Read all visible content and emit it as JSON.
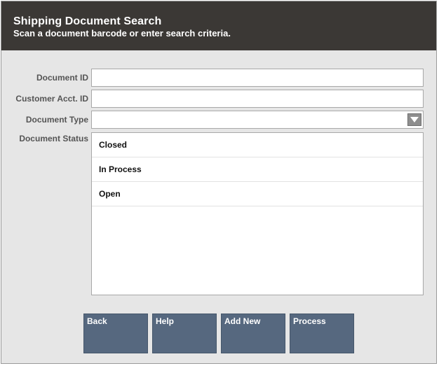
{
  "header": {
    "title": "Shipping Document Search",
    "subtitle": "Scan a document barcode or enter search criteria."
  },
  "form": {
    "document_id": {
      "label": "Document ID",
      "value": ""
    },
    "customer_acct_id": {
      "label": "Customer Acct. ID",
      "value": ""
    },
    "document_type": {
      "label": "Document Type",
      "value": ""
    },
    "document_status": {
      "label": "Document Status",
      "options": [
        "Closed",
        "In Process",
        "Open"
      ]
    }
  },
  "buttons": {
    "back": "Back",
    "help": "Help",
    "add_new": "Add New",
    "process": "Process"
  },
  "colors": {
    "header_bg": "#3b3835",
    "panel_bg": "#e6e6e6",
    "button_bg": "#56687f"
  }
}
